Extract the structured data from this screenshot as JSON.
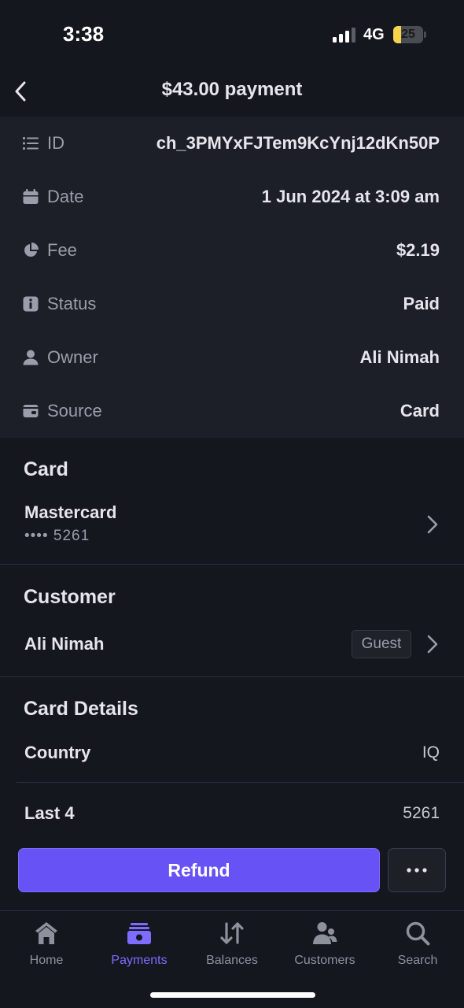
{
  "status_bar": {
    "time": "3:38",
    "network": "4G",
    "battery": "25",
    "battery_level": 0.25
  },
  "header": {
    "title": "$43.00 payment"
  },
  "details": [
    {
      "icon": "list-icon",
      "label": "ID",
      "value": "ch_3PMYxFJTem9KcYnj12dKn50P"
    },
    {
      "icon": "calendar-icon",
      "label": "Date",
      "value": "1 Jun 2024 at 3:09 am"
    },
    {
      "icon": "pie-chart-icon",
      "label": "Fee",
      "value": "$2.19"
    },
    {
      "icon": "info-icon",
      "label": "Status",
      "value": "Paid"
    },
    {
      "icon": "person-icon",
      "label": "Owner",
      "value": "Ali Nimah"
    },
    {
      "icon": "wallet-icon",
      "label": "Source",
      "value": "Card"
    }
  ],
  "card_section": {
    "title": "Card",
    "brand": "Mastercard",
    "masked": "•••• 5261"
  },
  "customer_section": {
    "title": "Customer",
    "name": "Ali Nimah",
    "badge": "Guest"
  },
  "card_details": {
    "title": "Card Details",
    "rows": [
      {
        "label": "Country",
        "value": "IQ"
      },
      {
        "label": "Last 4",
        "value": "5261"
      }
    ]
  },
  "actions": {
    "refund": "Refund",
    "more": "more-icon"
  },
  "tabbar": {
    "active": "Payments",
    "tabs": [
      {
        "label": "Home",
        "icon": "home-icon"
      },
      {
        "label": "Payments",
        "icon": "payments-icon"
      },
      {
        "label": "Balances",
        "icon": "balances-icon"
      },
      {
        "label": "Customers",
        "icon": "customers-icon"
      },
      {
        "label": "Search",
        "icon": "search-icon"
      }
    ]
  },
  "colors": {
    "accent": "#6652f5",
    "background": "#15171e",
    "panel": "#1c1f27"
  }
}
